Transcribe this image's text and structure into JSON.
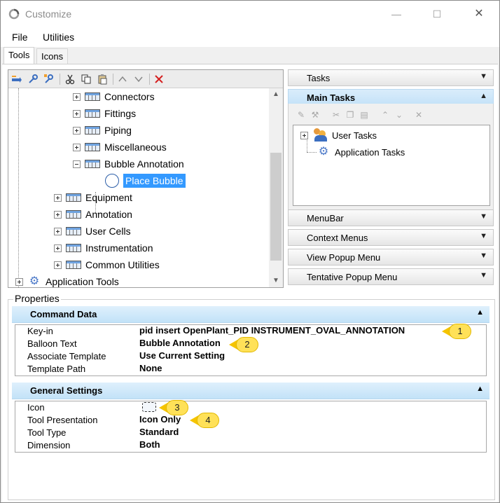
{
  "window": {
    "title": "Customize",
    "minimize_glyph": "—",
    "maximize_glyph": "☐",
    "close_glyph": "✕"
  },
  "menu": {
    "items": [
      "File",
      "Utilities"
    ]
  },
  "tabs": [
    "Tools",
    "Icons"
  ],
  "left_toolbar_icons": [
    "new-tool-icon",
    "new-key-icon",
    "new-branch-icon",
    "cut-icon",
    "copy-icon",
    "paste-icon",
    "move-up-icon",
    "move-down-icon",
    "delete-icon"
  ],
  "tree": {
    "items": [
      {
        "label": "Connectors",
        "expander": "plus"
      },
      {
        "label": "Fittings",
        "expander": "plus"
      },
      {
        "label": "Piping",
        "expander": "plus"
      },
      {
        "label": "Miscellaneous",
        "expander": "plus"
      },
      {
        "label": "Bubble Annotation",
        "expander": "minus"
      },
      {
        "label": "Place Bubble",
        "selected": true
      },
      {
        "label": "Equipment",
        "expander": "plus"
      },
      {
        "label": "Annotation",
        "expander": "plus"
      },
      {
        "label": "User Cells",
        "expander": "plus"
      },
      {
        "label": "Instrumentation",
        "expander": "plus"
      },
      {
        "label": "Common Utilities",
        "expander": "plus"
      },
      {
        "label": "Application Tools",
        "expander": "plus"
      }
    ]
  },
  "right_panel": {
    "tasks": "Tasks",
    "main_tasks": "Main Tasks",
    "main_tasks_tree": [
      "User Tasks",
      "Application Tasks"
    ],
    "menubar": "MenuBar",
    "context_menus": "Context Menus",
    "view_popup_menu": "View Popup Menu",
    "tentative_popup_menu": "Tentative Popup Menu",
    "chevron_down": "⌄",
    "chevron_up": "⌃"
  },
  "properties": {
    "label": "Properties",
    "command_data": {
      "title": "Command Data",
      "rows": [
        {
          "name": "Key-in",
          "value": "pid insert OpenPlant_PID INSTRUMENT_OVAL_ANNOTATION"
        },
        {
          "name": "Balloon Text",
          "value": "Bubble Annotation"
        },
        {
          "name": "Associate Template",
          "value": "Use Current Setting"
        },
        {
          "name": "Template Path",
          "value": "None"
        }
      ]
    },
    "general_settings": {
      "title": "General Settings",
      "rows": [
        {
          "name": "Icon",
          "value": ""
        },
        {
          "name": "Tool Presentation",
          "value": "Icon Only"
        },
        {
          "name": "Tool Type",
          "value": "Standard"
        },
        {
          "name": "Dimension",
          "value": "Both"
        }
      ]
    }
  },
  "callouts": [
    "1",
    "2",
    "3",
    "4"
  ],
  "colors": {
    "selection": "#3399ff",
    "callout_fill": "#ffe158",
    "section_header": "#c2e2f8",
    "delete_icon": "#d42020"
  }
}
